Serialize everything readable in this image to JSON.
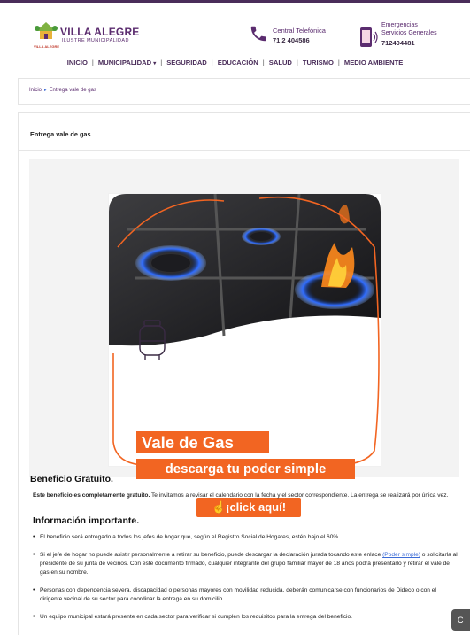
{
  "header": {
    "logo_name": "VILLA ALEGRE",
    "logo_sub": "ILUSTRE MUNICIPALIDAD",
    "logo_tiny": "VILLA ALEGRE",
    "central_label": "Central Telefónica",
    "central_number": "71 2 404586",
    "emergency_line1": "Emergencias",
    "emergency_line2": "Servicios Generales",
    "emergency_number": "712404481",
    "accent_color": "#5b2c6f"
  },
  "nav": {
    "items": [
      "INICIO",
      "MUNICIPALIDAD",
      "SEGURIDAD",
      "EDUCACIÓN",
      "SALUD",
      "TURISMO",
      "MEDIO AMBIENTE"
    ],
    "separator": "|",
    "dropdown_caret": "▾"
  },
  "breadcrumb": {
    "home": "Inicio",
    "arrow": "▸",
    "current": "Entrega vale de gas"
  },
  "page": {
    "title": "Entrega vale de gas"
  },
  "banner": {
    "title": "Vale de Gas",
    "subtitle": "descarga tu poder simple",
    "button": "¡click aquí!",
    "button_icon": "☝",
    "brand_color": "#f26522"
  },
  "benefit": {
    "heading": "Beneficio Gratuito.",
    "bold_text": "Este beneficio es completamente gratuito.",
    "text": " Te invitamos a revisar el calendario con la fecha y el sector correspondiente. La entrega se realizará por única vez."
  },
  "info": {
    "heading": "Información importante.",
    "item1": "El beneficio será entregado a todos los jefes de hogar que, según el Registro Social de Hogares, estén bajo el 60%.",
    "item2_before": "Si el jefe de hogar no puede asistir personalmente a retirar su beneficio, puede descargar la declaración jurada tocando este enlace ",
    "item2_link": "(Poder simple)",
    "item2_after": " o solicitarla al presidente de su junta de vecinos. Con este documento firmado, cualquier integrante del grupo familiar mayor de 18 años podrá presentarlo y retirar el vale de gas en su nombre.",
    "item3": "Personas con dependencia severa, discapacidad o personas mayores con movilidad reducida, deberán comunicarse con funcionarios de Dideco o con el dirigente vecinal de su sector para coordinar la entrega en su domicilio.",
    "item4": "Un equipo municipal estará presente en cada sector para verificar si cumplen los requisitos para la entrega del beneficio."
  },
  "chat": {
    "label": "C"
  }
}
